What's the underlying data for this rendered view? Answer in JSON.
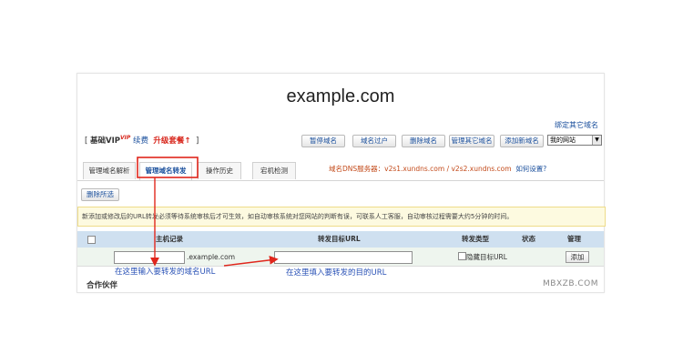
{
  "header": {
    "domain": "example.com",
    "bind_other_domain": "绑定其它域名"
  },
  "plan": {
    "bracket_open": "[",
    "tier": "基础VIP",
    "vip_badge": "VIP",
    "renew": "续费",
    "upgrade": "升级套餐",
    "upgrade_arrow": "↑",
    "bracket_close": "]"
  },
  "actions": {
    "pause": "暂停域名",
    "transfer": "域名过户",
    "delete": "删除域名",
    "manage_other": "管理其它域名",
    "add_new": "添加新域名"
  },
  "site_select": {
    "value": "我的网站"
  },
  "tabs": [
    {
      "label": "管理域名解析",
      "active": false
    },
    {
      "label": "管理域名转发",
      "active": true
    },
    {
      "label": "操作历史",
      "active": false
    },
    {
      "label": "宕机检测",
      "active": false
    }
  ],
  "dns": {
    "label": "域名DNS服务器：v2s1.xundns.com / v2s2.xundns.com",
    "howto": "如何设置?"
  },
  "delete_selected": "删除所选",
  "notice": "新添加或修改后的URL转发必须等待系统审核后才可生效，如自动审核系统对您网站的判断有误，可联系人工客服，自动审核过程需要大约5分钟的时间。",
  "table": {
    "headers": {
      "host": "主机记录",
      "target": "转发目标URL",
      "type": "转发类型",
      "status": "状态",
      "manage": "管理"
    },
    "row": {
      "host_value": "",
      "host_suffix": ".example.com",
      "target_value": "",
      "hide_url": "隐藏目标URL",
      "add": "添加"
    }
  },
  "annotations": {
    "host_hint": "在这里输入要转发的域名URL",
    "target_hint": "在这里填入要转发的目的URL"
  },
  "partners": "合作伙伴",
  "watermark": "MBXZB.COM",
  "colors": {
    "annotation_red": "#e0261c",
    "annotation_blue": "#2a52b6",
    "table_header": "#cfe0f0",
    "notice_bg": "#fdfae0"
  }
}
